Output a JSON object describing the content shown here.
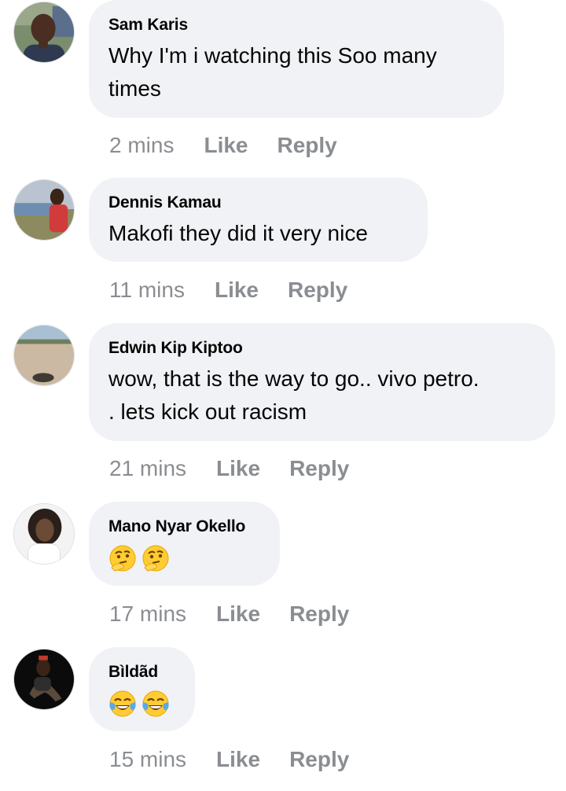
{
  "comments": [
    {
      "author": "Sam Karis",
      "text": "Why I'm i watching this Soo many\ntimes",
      "emojis": [],
      "time": "2 mins",
      "like": "Like",
      "reply": "Reply",
      "avatar": "sam-karis-avatar"
    },
    {
      "author": "Dennis Kamau",
      "text": "Makofi they did it very nice",
      "emojis": [],
      "time": "11 mins",
      "like": "Like",
      "reply": "Reply",
      "avatar": "dennis-kamau-avatar"
    },
    {
      "author": "Edwin Kip Kiptoo",
      "text": "wow, that is the way to go.. vivo petro.\n. lets kick out racism",
      "emojis": [],
      "time": "21 mins",
      "like": "Like",
      "reply": "Reply",
      "avatar": "edwin-kip-kiptoo-avatar"
    },
    {
      "author": "Mano Nyar Okello",
      "text": "",
      "emojis": [
        "thinking-face-emoji",
        "thinking-face-emoji"
      ],
      "time": "17 mins",
      "like": "Like",
      "reply": "Reply",
      "avatar": "mano-nyar-okello-avatar"
    },
    {
      "author": "Bìldãd",
      "text": "",
      "emojis": [
        "tears-of-joy-emoji",
        "tears-of-joy-emoji"
      ],
      "time": "15 mins",
      "like": "Like",
      "reply": "Reply",
      "avatar": "bildad-avatar"
    }
  ],
  "colors": {
    "bubble": "#f0f2f5",
    "text": "#050505",
    "meta": "#8a8d91"
  }
}
